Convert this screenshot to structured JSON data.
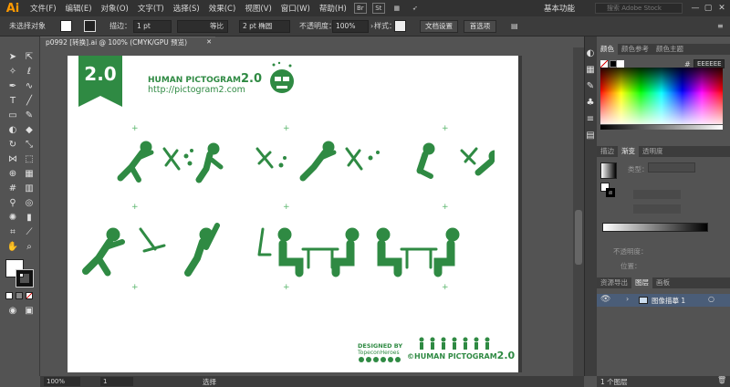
{
  "app": {
    "logo": "Ai"
  },
  "menubar": {
    "items": [
      "文件(F)",
      "编辑(E)",
      "对象(O)",
      "文字(T)",
      "选择(S)",
      "效果(C)",
      "视图(V)",
      "窗口(W)",
      "帮助(H)"
    ],
    "workspace": "基本功能",
    "search_placeholder": "搜索 Adobe Stock",
    "br_label": "Br",
    "st_label": "St"
  },
  "controlbar": {
    "selection_label": "未选择对象",
    "stroke_label": "描边：",
    "stroke_value": "1 pt",
    "stroke_profile": "等比",
    "brush_value": "2 pt 椭圆",
    "opacity_label": "不透明度：",
    "opacity_value": "100%",
    "style_label": "样式：",
    "doc_setup_button": "文档设置",
    "prefs_button": "首选项"
  },
  "document": {
    "tab_title": "p0992 [转换].ai @ 100% (CMYK/GPU 预览)",
    "zoom": "100%",
    "artboard_number": "1",
    "status_tool": "选择"
  },
  "artwork": {
    "badge_text": "2.0",
    "title_text": "HUMAN PICTOGRAM",
    "title_version": "2.0",
    "url": "http://pictogram2.com",
    "designed_by": "DESIGNED BY",
    "designer": "TopeconHeroes",
    "copyright_text": "©HUMAN PICTOGRAM",
    "copyright_version": "2.0",
    "green": "#2f8a43"
  },
  "panels": {
    "color_tabs": [
      "颜色",
      "颜色参考",
      "颜色主题"
    ],
    "hex_value": "EEEEEE",
    "gradient_tabs": [
      "描边",
      "渐变",
      "透明度"
    ],
    "gradient_type_label": "类型：",
    "opacity_label": "不透明度：",
    "position_label": "位置：",
    "layers_tabs": [
      "资源导出",
      "图层",
      "画板"
    ],
    "layer_name": "图像描摹 1",
    "layers_count": "1 个图层"
  }
}
